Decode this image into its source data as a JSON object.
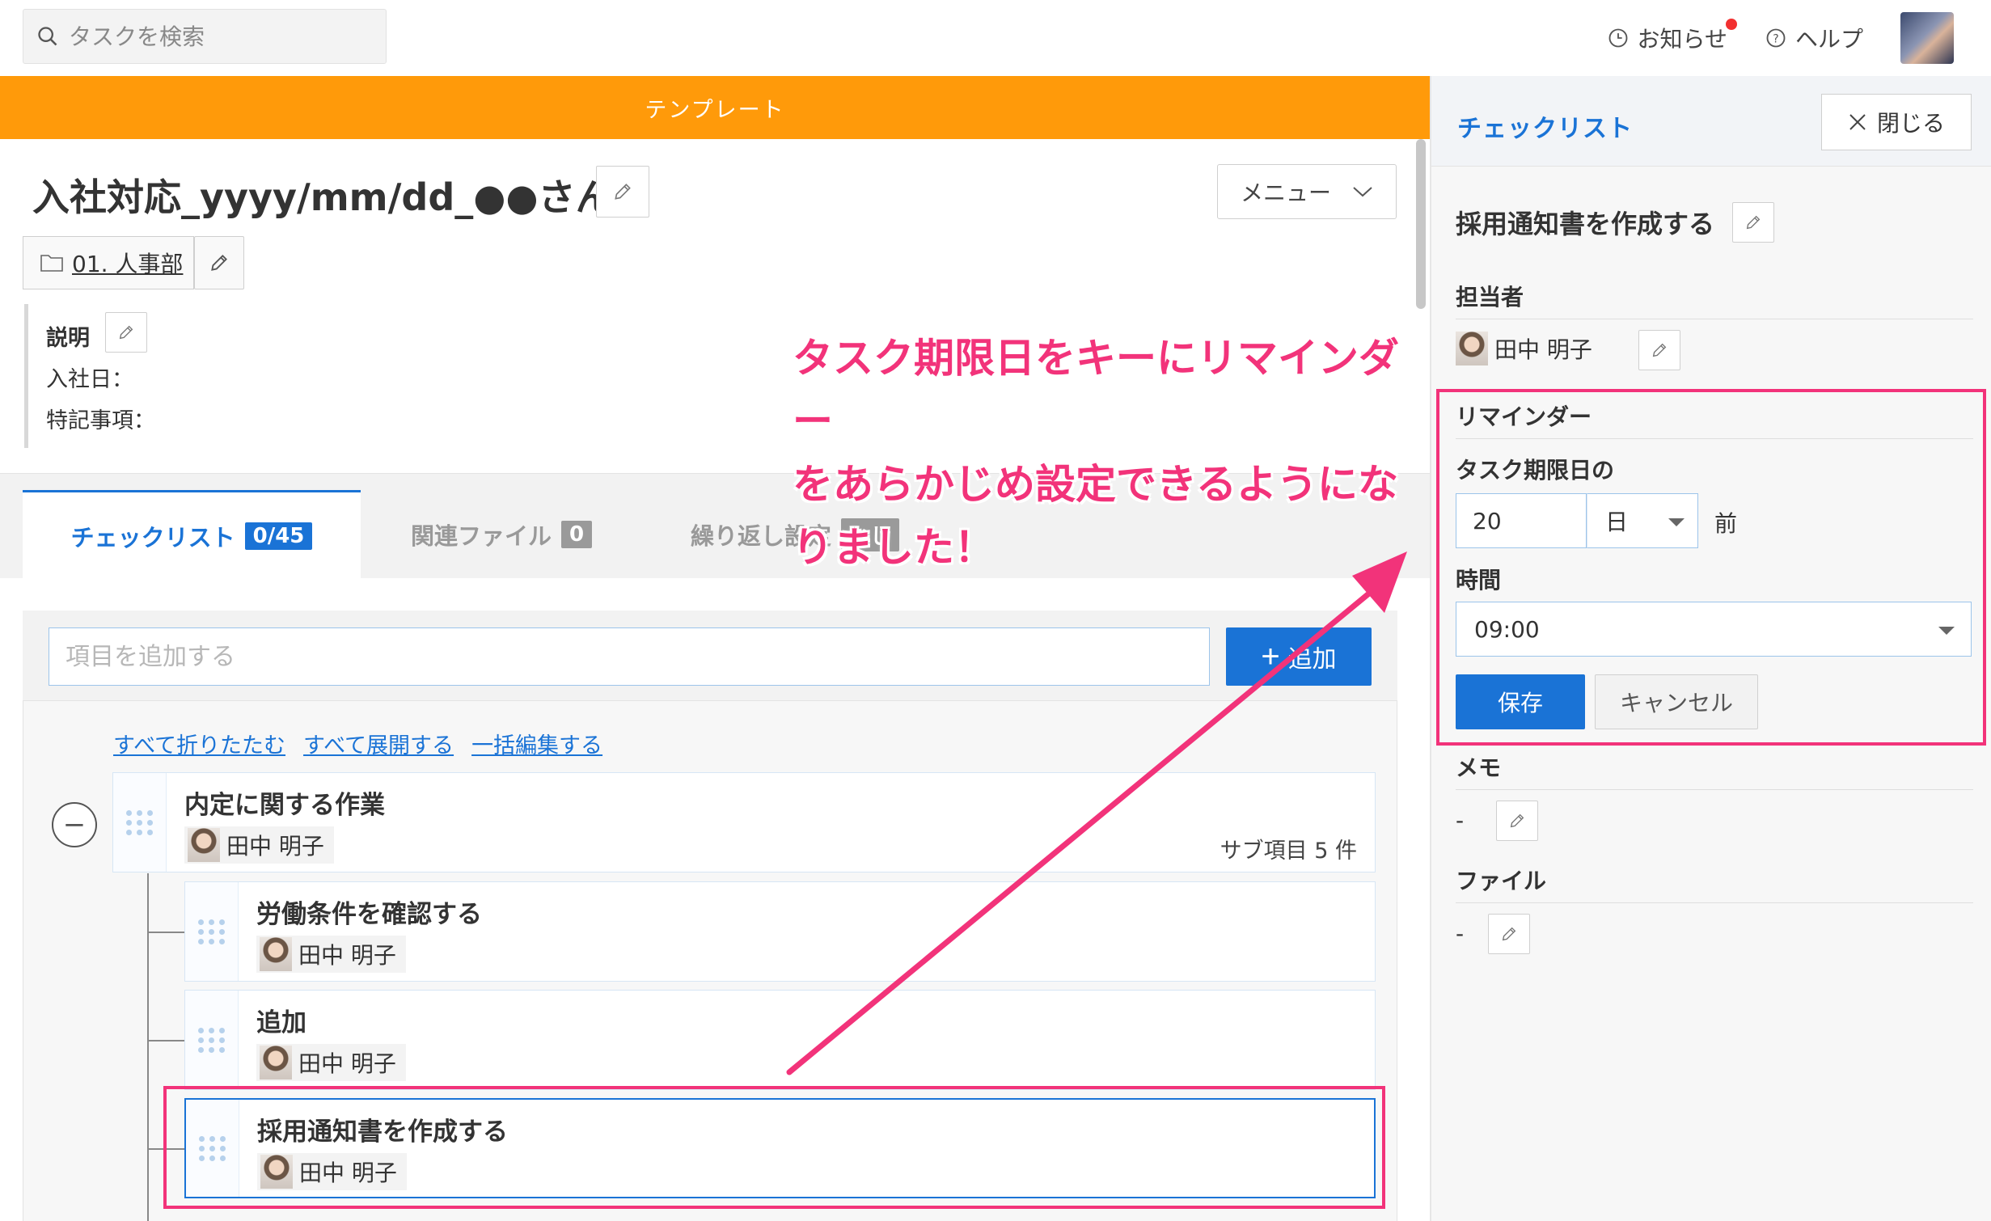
{
  "search": {
    "placeholder": "タスクを検索"
  },
  "top_nav": {
    "notifications": "お知らせ",
    "help": "ヘルプ"
  },
  "banner": "テンプレート",
  "page": {
    "title": "入社対応_yyyy/mm/dd_●●さん",
    "menu_label": "メニュー",
    "folder": "01. 人事部",
    "description_label": "説明",
    "description_lines": [
      "入社日：",
      "特記事項："
    ]
  },
  "tabs": [
    {
      "label": "チェックリスト",
      "badge": "0/45",
      "active": true
    },
    {
      "label": "関連ファイル",
      "badge": "0"
    },
    {
      "label": "繰り返し設定",
      "badge": "なし"
    }
  ],
  "checklist": {
    "add_placeholder": "項目を追加する",
    "add_button": "追加",
    "links": [
      "すべて折りたたむ",
      "すべて展開する",
      "一括編集する"
    ],
    "collapse_symbol": "−",
    "items": [
      {
        "title": "内定に関する作業",
        "assignee": "田中 明子",
        "sub_count": "サブ項目 5 件"
      },
      {
        "title": "労働条件を確認する",
        "assignee": "田中 明子"
      },
      {
        "title": "追加",
        "assignee": "田中 明子"
      },
      {
        "title": "採用通知書を作成する",
        "assignee": "田中 明子"
      }
    ]
  },
  "annotation": {
    "lines": [
      "タスク期限日をキーにリマインダー",
      "をあらかじめ設定できるようにな",
      "りました！"
    ]
  },
  "right_panel": {
    "title": "チェックリスト",
    "close_label": "閉じる",
    "task_title": "採用通知書を作成する",
    "assignee_label": "担当者",
    "assignee": "田中 明子",
    "reminder_label": "リマインダー",
    "due_label": "タスク期限日の",
    "offset_value": "20",
    "offset_unit": "日",
    "before": "前",
    "time_label": "時間",
    "time_value": "09:00",
    "save": "保存",
    "cancel": "キャンセル",
    "memo_label": "メモ",
    "memo_value": "-",
    "file_label": "ファイル",
    "file_value": "-"
  },
  "colors": {
    "accent": "#1a73d6",
    "banner": "#ff9a0a",
    "highlight": "#f2337a"
  }
}
